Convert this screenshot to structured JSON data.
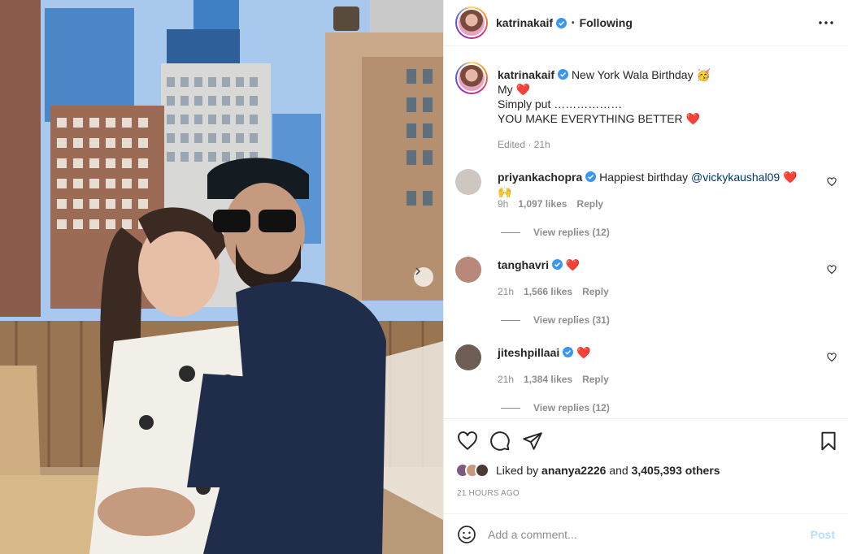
{
  "post": {
    "author": "katrinakaif",
    "follow_status": "Following",
    "caption_title": "New York Wala Birthday 🥳",
    "caption_lines": [
      "My ❤️",
      "Simply put ………………",
      "YOU MAKE EVERYTHING BETTER ❤️"
    ],
    "caption_meta": "Edited · 21h"
  },
  "comments": [
    {
      "user": "priyankachopra",
      "text": "Happiest birthday ",
      "mention": "@vickykaushal09",
      "emoji": "❤️ 🙌",
      "age": "9h",
      "likes": "1,097 likes",
      "reply": "Reply",
      "view_replies": "View replies (12)",
      "avatar_color": "#cfc6c0"
    },
    {
      "user": "tanghavri",
      "text": "",
      "mention": "",
      "emoji": "❤️",
      "age": "21h",
      "likes": "1,566 likes",
      "reply": "Reply",
      "view_replies": "View replies (31)",
      "avatar_color": "#b8897a"
    },
    {
      "user": "jiteshpillaai",
      "text": "",
      "mention": "",
      "emoji": "❤️",
      "age": "21h",
      "likes": "1,384 likes",
      "reply": "Reply",
      "view_replies": "View replies (12)",
      "avatar_color": "#6f5e55"
    }
  ],
  "likes": {
    "prefix": "Liked by ",
    "liked_by": "ananya2226",
    "middle": " and ",
    "others": "3,405,393 others"
  },
  "timestamp": "21 HOURS AGO",
  "comment_box": {
    "placeholder": "Add a comment...",
    "post_label": "Post"
  },
  "colors": {
    "verified": "#3897f0",
    "heart": "#ed4956",
    "post_disabled": "#b2dffc"
  }
}
